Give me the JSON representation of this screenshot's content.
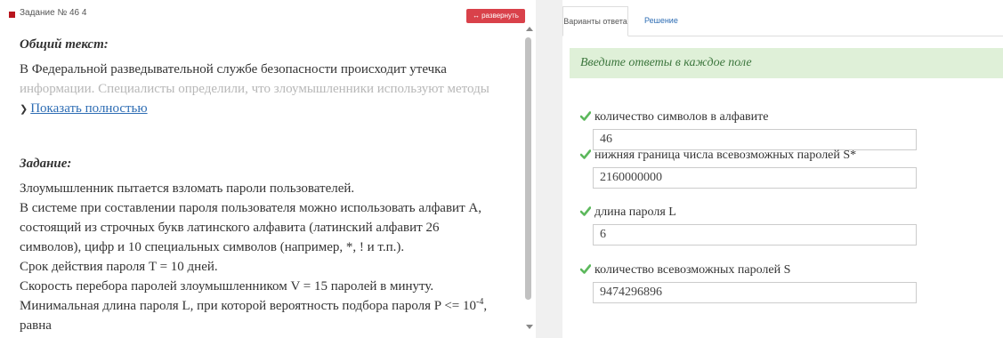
{
  "task": {
    "number_label": "Задание № 46 4",
    "expand_label": "развернуть"
  },
  "general": {
    "heading": "Общий текст:",
    "line1": "В Федеральной разведывательной службе безопасности происходит утечка",
    "line2": "информации. Специалисты определили, что злоумышленники используют методы",
    "show_more": "Показать полностью"
  },
  "assignment": {
    "heading": "Задание:",
    "line1": "Злоумышленник пытается взломать пароли пользователей.",
    "line2": "В системе при составлении пароля пользователя можно использовать алфавит A,",
    "line3": "состоящий из строчных букв латинского алфавита (латинский алфавит 26",
    "line4": "символов), цифр и 10 специальных символов (например, *, ! и т.п.).",
    "line5": "Срок действия пароля T = 10 дней.",
    "line6": "Скорость перебора паролей злоумышленником V = 15 паролей в минуту.",
    "line7_pre": "Минимальная длина пароля L, при которой вероятность подбора пароля P <= 10",
    "line7_sup": "-4",
    "line7_post": ",",
    "line8": "равна"
  },
  "tabs": {
    "answers": "Варианты ответа",
    "solution": "Решение"
  },
  "alert": "Введите ответы в каждое поле",
  "fields": [
    {
      "label": "количество символов в алфавите",
      "value": "46"
    },
    {
      "label": "нижняя граница числа всевозможных паролей S*",
      "value": "2160000000"
    },
    {
      "label": "длина пароля L",
      "value": "6"
    },
    {
      "label": "количество всевозможных паролей S",
      "value": "9474296896"
    }
  ],
  "colors": {
    "accent_red": "#d9414a",
    "link_blue": "#2e6db4",
    "alert_bg": "#dff0d8",
    "check_green": "#5cb85c"
  }
}
